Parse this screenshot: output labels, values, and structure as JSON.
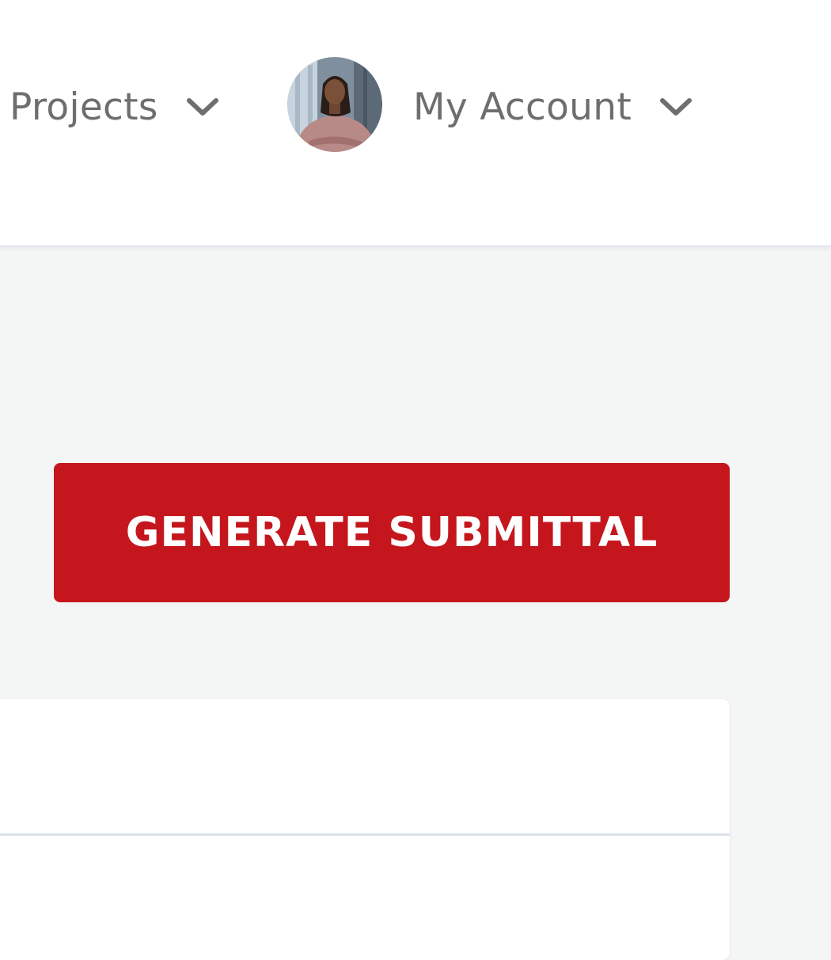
{
  "nav": {
    "projects_label": "Projects",
    "projects_icon": "chevron-down-icon",
    "account_label": "My Account",
    "account_icon": "chevron-down-icon",
    "avatar_icon": "user-avatar"
  },
  "actions": {
    "generate_label": "GENERATE SUBMITTAL"
  },
  "colors": {
    "primary": "#c5161d",
    "nav_text": "#6d6e70",
    "page_background": "#f4f5f5",
    "divider": "#dde3ec"
  }
}
